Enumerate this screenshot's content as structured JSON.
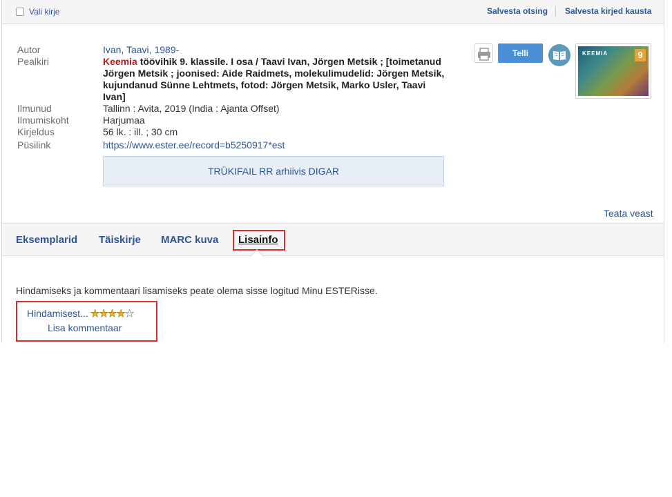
{
  "toolbar": {
    "select_label": "Vali kirje",
    "save_search": "Salvesta otsing",
    "save_to_folder": "Salvesta kirjed kausta"
  },
  "record": {
    "fields": [
      {
        "label": "Autor",
        "value": "Ivan, Taavi, 1989-"
      },
      {
        "label": "Pealkiri",
        "value_highlight": "Keemia",
        "value": " töövihik 9. klassile. I osa / Taavi Ivan, Jörgen Metsik ; [toimetanud Jörgen Metsik ; joonised: Aide Raidmets, molekulimudelid: Jörgen Metsik, kujundanud Sünne Lehtmets, fotod: Jörgen Metsik, Marko Usler, Taavi Ivan]"
      },
      {
        "label": "Ilmunud",
        "value": "Tallinn : Avita, 2019 (India : Ajanta Offset)"
      },
      {
        "label": "Ilmumiskoht",
        "value": "Harjumaa"
      },
      {
        "label": "Kirjeldus",
        "value": "56 lk. : ill. ; 30 cm"
      },
      {
        "label": "Püsilink",
        "value": "https://www.ester.ee/record=b5250917*est"
      }
    ],
    "digar_button": "TRÜKIFAIL RR arhiivis DIGAR"
  },
  "actions": {
    "order_label": "Telli",
    "print_icon": "printer-icon",
    "read_icon": "book-icon",
    "cover_title": "KEEMIA",
    "cover_number": "9"
  },
  "report_error": "Teata veast",
  "tabs": [
    {
      "label": "Eksemplarid",
      "active": false
    },
    {
      "label": "Täiskirje",
      "active": false
    },
    {
      "label": "MARC kuva",
      "active": false
    },
    {
      "label": "Lisainfo",
      "active": true
    }
  ],
  "lisainfo": {
    "notice": "Hindamiseks ja kommentaari lisamiseks peate olema sisse logitud Minu ESTERisse.",
    "rating_link": "Hindamisest...",
    "rating": 4,
    "rating_max": 5,
    "add_comment": "Lisa kommentaar"
  },
  "colors": {
    "link": "#2f5496",
    "highlight": "#b71c1c",
    "button": "#4a90d9",
    "annotation_box": "#d32f2f"
  }
}
